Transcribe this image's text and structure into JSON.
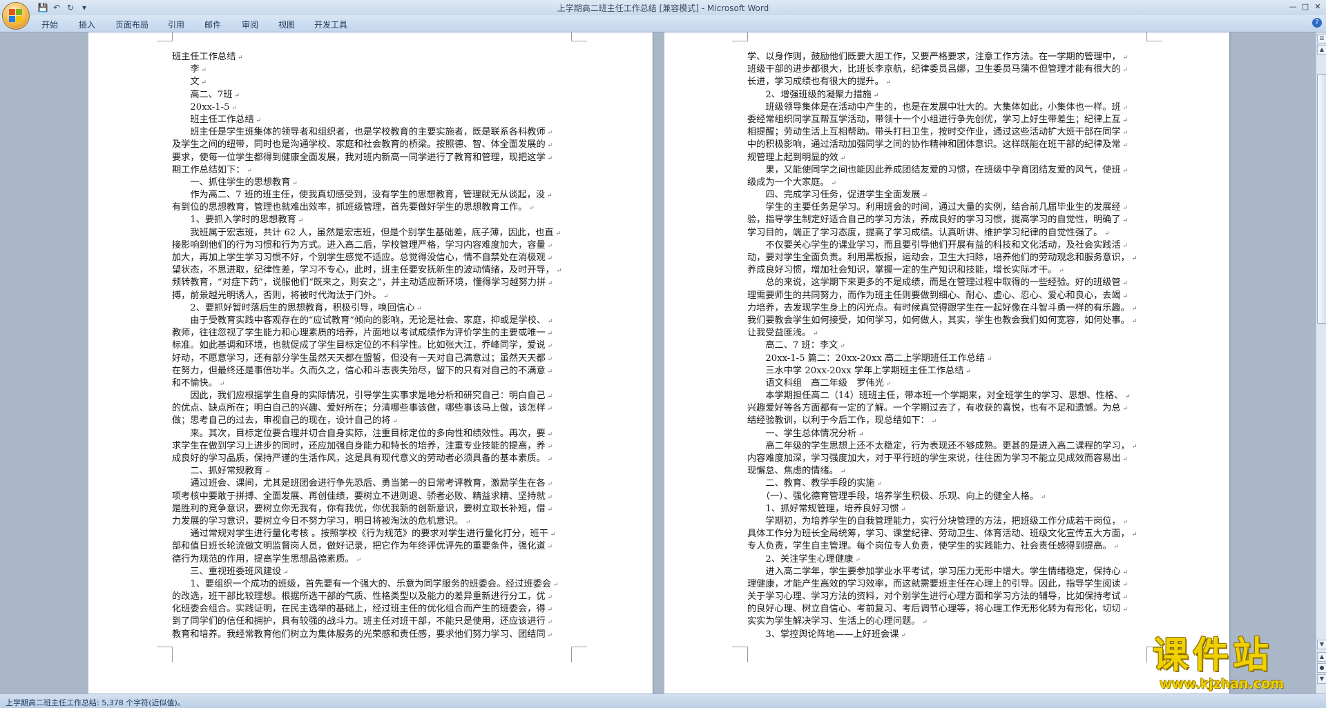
{
  "window": {
    "title": "上学期高二班主任工作总结 [兼容模式] - Microsoft Word"
  },
  "ribbon": {
    "tabs": [
      "开始",
      "插入",
      "页面布局",
      "引用",
      "邮件",
      "审阅",
      "视图",
      "开发工具"
    ]
  },
  "document": {
    "left_page_lines": [
      "班主任工作总结",
      "　　李",
      "　　文",
      "　　高二、7班",
      "　　20xx-1-5",
      "　　班主任工作总结",
      "　　班主任是学生班集体的领导者和组织者，也是学校教育的主要实施者，既是联系各科教师",
      "及学生之间的纽带，同时也是沟通学校、家庭和社会教育的桥梁。按照德、智、体全面发展的",
      "要求，使每一位学生都得到健康全面发展，我对班内新高一同学进行了教育和管理，现把这学",
      "期工作总结如下：",
      "　　一、抓住学生的思想教育",
      "　　作为高二、7 班的班主任，使我真切感受到，没有学生的思想教育，管理就无从谈起，没",
      "有到位的思想教育，管理也就难出效率，抓班级管理，首先要做好学生的思想教育工作。",
      "　　1、要抓入学时的思想教育",
      "　　我班属于宏志班，共计 62 人，虽然是宏志班，但是个别学生基础差，底子薄，因此，也直",
      "接影响到他们的行为习惯和行为方式。进入高二后，学校管理严格，学习内容难度加大，容量",
      "加大，再加上学生学习习惯不好，个别学生感觉不适应。总觉得没信心，情不自禁处在消极观",
      "望状态，不思进取，纪律性差，学习不专心，此时，班主任要安抚新生的波动情绪，及时开导，",
      "频转教育，“对症下药”，说服他们“既来之，则安之”，并主动适应新环境，懂得学习越努力拼",
      "搏，前景越光明诱人，否则，将被时代淘汰于门外。",
      "　　2、要抓好暂时落后生的思想教育，积极引导，唤回信心",
      "　　由于受教育实践中客观存在的“应试教育”倾向的影响，无论是社会、家庭，抑或是学校、",
      "教师，往往忽视了学生能力和心理素质的培养，片面地以考试成绩作为评价学生的主要或唯一",
      "标准。如此基调和环境，也就促成了学生目标定位的不科学性。比如张大江，乔峰同学，爱说",
      "好动，不愿意学习，还有部分学生虽然天天都在盟誓，但没有一天对自己满意过；虽然天天都",
      "在努力，但最终还是事倍功半。久而久之，信心和斗志丧失殆尽，留下的只有对自己的不满意",
      "和不愉快。",
      "　　因此，我们应根据学生自身的实际情况，引导学生实事求是地分析和研究自己：明白自己",
      "的优点、缺点所在；明白自己的兴趣、爱好所在；分清哪些事该做，哪些事该马上做，该怎样",
      "做；思考自己的过去，审视自己的现在，设计自己的将",
      "　　来。其次，目标定位要合理并切合自身实际，注重目标定位的多向性和绩效性。再次，要",
      "求学生在做到学习上进步的同时，还应加强自身能力和特长的培养，注重专业技能的提高，养",
      "成良好的学习品质，保持严谨的生活作风，这是具有现代意义的劳动者必须具备的基本素质。",
      "　　二、抓好常规教育",
      "　　通过班会、课间，尤其是班团会进行争先恐后、勇当第一的日常考评教育，激励学生在各",
      "项考核中要敢于拼搏、全面发展、再创佳绩，要树立不进则退、骄者必败、精益求精、坚持就",
      "是胜利的竞争意识，要树立你无我有，你有我优，你优我新的创新意识，要树立取长补短，借",
      "力发展的学习意识，要树立今日不努力学习，明日将被淘汰的危机意识。",
      "　　通过常规对学生进行量化考核 。按照学校《行为规范》的要求对学生进行量化打分，班干",
      "部和值日班长轮流做文明监督岗人员，做好记录，把它作为年终评优评先的重要条件，强化道",
      "德行为规范的作用，提高学生思想品德素质。",
      "　　三、重视班委班风建设",
      "　　1、要组织一个成功的班级，首先要有一个强大的、乐意为同学服务的班委会。经过班委会",
      "的改选，班干部比较理想。根据所选干部的气质、性格类型以及能力的差异重新进行分工，优",
      "化班委会组合。实践证明，在民主选举的基础上，经过班主任的优化组合而产生的班委会，得",
      "到了同学们的信任和拥护，具有较强的战斗力。班主任对班干部，不能只是使用，还应该进行",
      "教育和培养。我经常教育他们树立为集体服务的光荣感和责任感，要求他们努力学习、团结同"
    ],
    "right_page_lines": [
      "学、以身作则，鼓励他们既要大胆工作，又要严格要求，注意工作方法。在一学期的管理中，",
      "班级干部的进步都很大，比班长李京航，纪律委员吕娜，卫生委员马蒲不但管理才能有很大的",
      "长进，学习成绩也有很大的提升。",
      "　　2、增强班级的凝聚力措施",
      "　　班级领导集体是在活动中产生的，也是在发展中壮大的。大集体如此，小集体也一样。班",
      "委经常组织同学互帮互学活动，带领十一个小组进行争先创优，学习上好生带差生；纪律上互",
      "相提醒；劳动生活上互相帮助。带头打扫卫生，按时交作业，通过这些活动扩大班干部在同学",
      "中的积极影响，通过活动加强同学之间的协作精神和团体意识。这样既能在班干部的纪律及常",
      "规管理上起到明显的效",
      "　　果，又能使同学之间也能因此养成团结友爱的习惯，在班级中孕育团结友爱的风气，使班",
      "级成为一个大家庭。",
      "　　四、完成学习任务，促进学生全面发展",
      "　　学生的主要任务是学习。利用班会的时间，通过大量的实例，结合前几届毕业生的发展经",
      "验，指导学生制定好适合自己的学习方法，养成良好的学习习惯，提高学习的自觉性，明确了",
      "学习目的，端正了学习态度，提高了学习成绩。认真听讲、维护学习纪律的自觉性强了。",
      "　　不仅要关心学生的课业学习，而且要引导他们开展有益的科技和文化活动，及社会实践活",
      "动，要对学生全面负责。利用黑板报，运动会，卫生大扫除，培养他们的劳动观念和服务意识，",
      "养成良好习惯，增加社会知识，掌握一定的生产知识和技能，增长实际才干。",
      "　　总的来说，这学期下来更多的不是成绩，而是在管理过程中取得的一些经验。好的班级管",
      "理需要师生的共同努力，而作为班主任则要做到细心、耐心、虚心、忍心、爱心和良心，去竭",
      "力培养，去发现学生身上的闪光点。有时候真觉得跟学生在一起好像在斗智斗勇一样的有乐趣。",
      "我们要教会学生如何接受，如何学习，如何做人，其实，学生也教会我们如何宽容，如何处事。",
      "让我受益匪浅。",
      "　　高二、7 班：李文",
      "　　20xx-1-5 篇二：20xx-20xx 高二上学期班任工作总结",
      "　　三水中学 20xx-20xx 学年上学期班主任工作总结",
      "　　语文科组　高二年级　罗伟光",
      "　　本学期担任高二（14）班班主任，带本班一个学期来，对全班学生的学习、思想、性格、",
      "兴趣爱好等各方面都有一定的了解。一个学期过去了，有收获的喜悦，也有不足和遗憾。为总",
      "结经验教训，以利于今后工作，现总结如下：",
      "　　一、学生总体情况分析",
      "　　高二年级的学生思想上还不太稳定，行为表现还不够成熟。更甚的是进入高二课程的学习，",
      "内容难度加深，学习强度加大，对于平行班的学生来说，往往因为学习不能立见成效而容易出",
      "现懈怠、焦虑的情绪。",
      "　　二、教育、教学手段的实施",
      "　　（一）、强化德育管理手段，培养学生积极、乐观、向上的健全人格。",
      "　　1、抓好常规管理，培养良好习惯",
      "　　学期初，为培养学生的自我管理能力，实行分块管理的方法，把班级工作分成若干岗位，",
      "具体工作分为班长全局统筹，学习、课堂纪律、劳动卫生、体育活动、班级文化宣传五大方面，",
      "专人负责，学生自主管理。每个岗位专人负责，使学生的实践能力、社会责任感得到提高。",
      "　　2、关注学生心理健康",
      "　　进入高二学年，学生要参加学业水平考试，学习压力无形中增大。学生情绪稳定，保持心",
      "理健康，才能产生高效的学习效率，而这就需要班主任在心理上的引导。因此，指导学生阅读",
      "关于学习心理、学习方法的资料，对个别学生进行心理方面和学习方法的辅导，比如保持考试",
      "的良好心理、树立自信心、考前复习、考后调节心理等，将心理工作无形化转为有形化，切切",
      "实实为学生解决学习、生活上的心理问题。",
      "　　3、掌控舆论阵地——上好班会课"
    ]
  },
  "statusbar": {
    "text": "上学期高二班主任工作总结: 5,378 个字符(近似值)。"
  },
  "watermark": {
    "title": "课件站",
    "url": "www.kjzhan.com"
  }
}
